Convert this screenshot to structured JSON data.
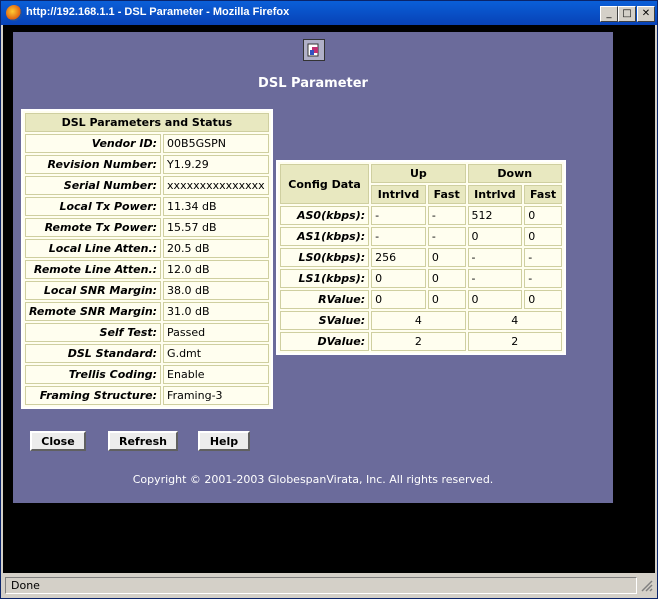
{
  "window": {
    "title": "http://192.168.1.1 - DSL Parameter - Mozilla Firefox"
  },
  "page": {
    "heading": "DSL Parameter",
    "copyright": "Copyright © 2001-2003 GlobespanVirata, Inc. All rights reserved."
  },
  "status_table": {
    "title": "DSL Parameters and Status",
    "rows": [
      {
        "label": "Vendor ID:",
        "value": "00B5GSPN"
      },
      {
        "label": "Revision Number:",
        "value": "Y1.9.29"
      },
      {
        "label": "Serial Number:",
        "value": "xxxxxxxxxxxxxxx"
      },
      {
        "label": "Local Tx Power:",
        "value": "11.34 dB"
      },
      {
        "label": "Remote Tx Power:",
        "value": "15.57 dB"
      },
      {
        "label": "Local Line Atten.:",
        "value": "20.5 dB"
      },
      {
        "label": "Remote Line Atten.:",
        "value": "12.0 dB"
      },
      {
        "label": "Local SNR Margin:",
        "value": "38.0 dB"
      },
      {
        "label": "Remote SNR Margin:",
        "value": "31.0 dB"
      },
      {
        "label": "Self Test:",
        "value": "Passed"
      },
      {
        "label": "DSL Standard:",
        "value": "G.dmt"
      },
      {
        "label": "Trellis Coding:",
        "value": "Enable"
      },
      {
        "label": "Framing Structure:",
        "value": "Framing-3"
      }
    ]
  },
  "config_table": {
    "corner": "Config Data",
    "up": "Up",
    "down": "Down",
    "sub": [
      "Intrlvd",
      "Fast",
      "Intrlvd",
      "Fast"
    ],
    "rows": [
      {
        "label": "AS0(kbps):",
        "cells": [
          "-",
          "-",
          "512",
          "0"
        ]
      },
      {
        "label": "AS1(kbps):",
        "cells": [
          "-",
          "-",
          "0",
          "0"
        ]
      },
      {
        "label": "LS0(kbps):",
        "cells": [
          "256",
          "0",
          "-",
          "-"
        ]
      },
      {
        "label": "LS1(kbps):",
        "cells": [
          "0",
          "0",
          "-",
          "-"
        ]
      },
      {
        "label": "RValue:",
        "cells": [
          "0",
          "0",
          "0",
          "0"
        ]
      }
    ],
    "svalue": {
      "label": "SValue:",
      "up": "4",
      "down": "4"
    },
    "dvalue": {
      "label": "DValue:",
      "up": "2",
      "down": "2"
    }
  },
  "buttons": {
    "close": "Close",
    "refresh": "Refresh",
    "help": "Help"
  },
  "status": {
    "text": "Done"
  }
}
